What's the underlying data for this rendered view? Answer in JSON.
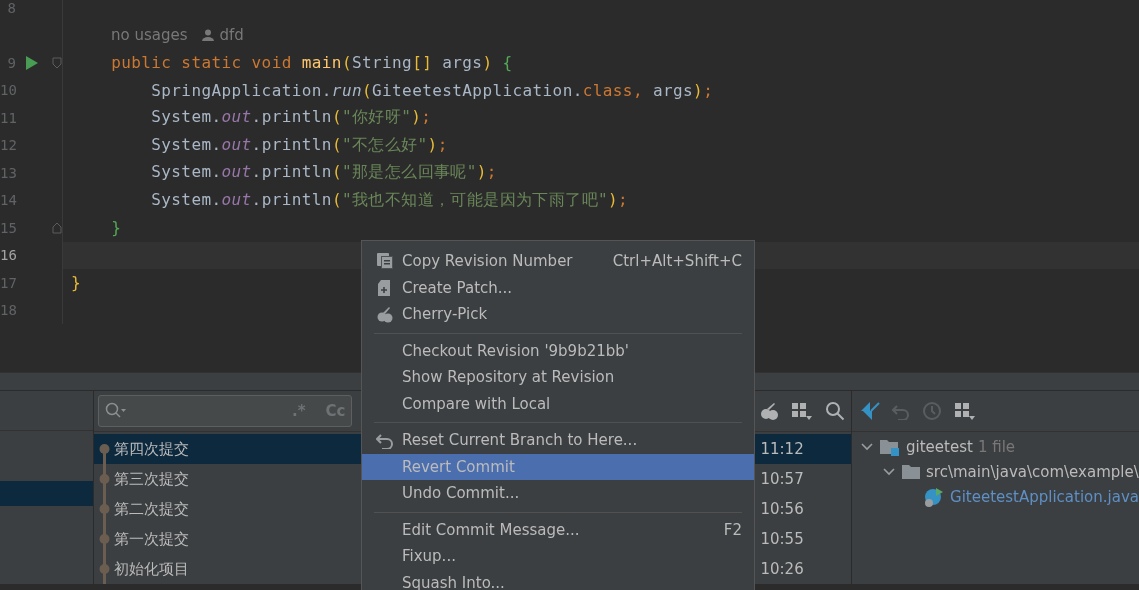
{
  "editor": {
    "lines": [
      {
        "kind": "code",
        "number": "8"
      },
      {
        "kind": "inlay",
        "usages": "no usages",
        "author": "dfd"
      },
      {
        "kind": "code",
        "number": "9",
        "run": true,
        "fold_start": true,
        "tokens": [
          {
            "kind": "kw",
            "text": "    public static void "
          },
          {
            "kind": "decl",
            "text": "main"
          },
          {
            "kind": "paren",
            "text": "("
          },
          {
            "kind": "plain",
            "text": "String"
          },
          {
            "kind": "paren",
            "text": "[]"
          },
          {
            "kind": "plain",
            "text": " args"
          },
          {
            "kind": "paren",
            "text": ")"
          },
          {
            "kind": "brace",
            "text": " {"
          }
        ]
      },
      {
        "kind": "code",
        "number": "10",
        "tokens": [
          {
            "kind": "plain",
            "text": "        SpringApplication."
          },
          {
            "kind": "italic",
            "text": "run"
          },
          {
            "kind": "paren",
            "text": "("
          },
          {
            "kind": "plain",
            "text": "GiteetestApplication."
          },
          {
            "kind": "kw",
            "text": "class, "
          },
          {
            "kind": "plain",
            "text": "args"
          },
          {
            "kind": "paren",
            "text": ")"
          },
          {
            "kind": "kw",
            "text": ";"
          }
        ]
      },
      {
        "kind": "code",
        "number": "11",
        "tokens": [
          {
            "kind": "plain",
            "text": "        System."
          },
          {
            "kind": "field",
            "text": "out"
          },
          {
            "kind": "plain",
            "text": ".println"
          },
          {
            "kind": "paren",
            "text": "("
          },
          {
            "kind": "str",
            "text": "\"你好呀\""
          },
          {
            "kind": "paren",
            "text": ")"
          },
          {
            "kind": "kw",
            "text": ";"
          }
        ]
      },
      {
        "kind": "code",
        "number": "12",
        "tokens": [
          {
            "kind": "plain",
            "text": "        System."
          },
          {
            "kind": "field",
            "text": "out"
          },
          {
            "kind": "plain",
            "text": ".println"
          },
          {
            "kind": "paren",
            "text": "("
          },
          {
            "kind": "str",
            "text": "\"不怎么好\""
          },
          {
            "kind": "paren",
            "text": ")"
          },
          {
            "kind": "kw",
            "text": ";"
          }
        ]
      },
      {
        "kind": "code",
        "number": "13",
        "tokens": [
          {
            "kind": "plain",
            "text": "        System."
          },
          {
            "kind": "field",
            "text": "out"
          },
          {
            "kind": "plain",
            "text": ".println"
          },
          {
            "kind": "paren",
            "text": "("
          },
          {
            "kind": "str",
            "text": "\"那是怎么回事呢\""
          },
          {
            "kind": "paren",
            "text": ")"
          },
          {
            "kind": "kw",
            "text": ";"
          }
        ]
      },
      {
        "kind": "code",
        "number": "14",
        "tokens": [
          {
            "kind": "plain",
            "text": "        System."
          },
          {
            "kind": "field",
            "text": "out"
          },
          {
            "kind": "plain",
            "text": ".println"
          },
          {
            "kind": "paren",
            "text": "("
          },
          {
            "kind": "str",
            "text": "\"我也不知道，可能是因为下雨了吧\""
          },
          {
            "kind": "paren",
            "text": ")"
          },
          {
            "kind": "kw",
            "text": ";"
          }
        ]
      },
      {
        "kind": "code",
        "number": "15",
        "fold_end": true,
        "tokens": [
          {
            "kind": "brace",
            "text": "    }"
          }
        ]
      },
      {
        "kind": "code",
        "number": "16",
        "current": true
      },
      {
        "kind": "code",
        "number": "17",
        "tokens": [
          {
            "kind": "paren",
            "text": "}"
          }
        ]
      },
      {
        "kind": "code",
        "number": "18"
      }
    ]
  },
  "log": {
    "search": {
      "regex": ".*",
      "case": "Cc"
    },
    "commits": [
      {
        "message": "第四次提交",
        "time": "11:12",
        "selected": true
      },
      {
        "message": "第三次提交",
        "time": "10:57",
        "selected": false
      },
      {
        "message": "第二次提交",
        "time": "10:56",
        "selected": false
      },
      {
        "message": "第一次提交",
        "time": "10:55",
        "selected": false
      },
      {
        "message": "初始化项目",
        "time": "10:26",
        "selected": false
      }
    ]
  },
  "changes": {
    "tree": [
      {
        "name": "giteetest",
        "count": "1 file",
        "expanded": true,
        "kind": "module",
        "children": [
          {
            "name": "src\\main\\java\\com\\example\\",
            "expanded": true,
            "kind": "folder",
            "children": [
              {
                "name": "GiteetestApplication.java",
                "kind": "class"
              }
            ]
          }
        ]
      }
    ]
  },
  "context_menu": {
    "items": [
      {
        "kind": "copy",
        "label": "Copy Revision Number",
        "shortcut": "Ctrl+Alt+Shift+C",
        "selected": false
      },
      {
        "kind": "patch",
        "label": "Create Patch...",
        "selected": false
      },
      {
        "kind": "cherry",
        "label": "Cherry-Pick",
        "selected": false
      },
      {
        "kind": "separator"
      },
      {
        "kind": "item",
        "label": "Checkout Revision '9b9b21bb'",
        "selected": false
      },
      {
        "kind": "item",
        "label": "Show Repository at Revision",
        "selected": false
      },
      {
        "kind": "item",
        "label": "Compare with Local",
        "selected": false
      },
      {
        "kind": "separator"
      },
      {
        "kind": "reset",
        "label": "Reset Current Branch to Here...",
        "selected": false
      },
      {
        "kind": "item",
        "label": "Revert Commit",
        "selected": true
      },
      {
        "kind": "item",
        "label": "Undo Commit...",
        "selected": false
      },
      {
        "kind": "separator"
      },
      {
        "kind": "item",
        "label": "Edit Commit Message...",
        "shortcut": "F2",
        "selected": false
      },
      {
        "kind": "item",
        "label": "Fixup...",
        "selected": false
      },
      {
        "kind": "item",
        "label": "Squash Into...",
        "selected": false
      }
    ]
  }
}
